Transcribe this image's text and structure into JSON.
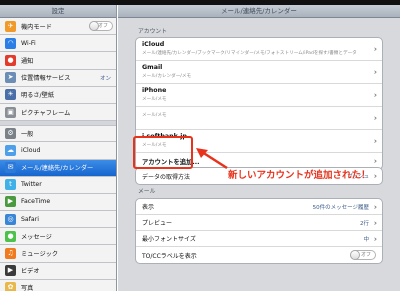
{
  "left": {
    "title": "設定",
    "items": [
      {
        "label": "機内モード",
        "icon": "airplane-icon",
        "color": "#f19a2a",
        "glyph": "✈",
        "toggle": "オフ"
      },
      {
        "label": "Wi-Fi",
        "icon": "wifi-icon",
        "color": "#2a7ee6",
        "glyph": "◠",
        "value": ""
      },
      {
        "label": "通知",
        "icon": "notifications-icon",
        "color": "#e23b2c",
        "glyph": "●"
      },
      {
        "label": "位置情報サービス",
        "icon": "location-icon",
        "color": "#6c8db5",
        "glyph": "➤",
        "value": "オン"
      },
      {
        "label": "明るさ/壁紙",
        "icon": "brightness-icon",
        "color": "#4a6fa8",
        "glyph": "☀"
      },
      {
        "label": "ピクチャフレーム",
        "icon": "picture-frame-icon",
        "color": "#8a8f96",
        "glyph": "▣"
      },
      {
        "label": "一般",
        "icon": "gear-icon",
        "color": "#7b8189",
        "glyph": "⚙",
        "gap": true
      },
      {
        "label": "iCloud",
        "icon": "icloud-icon",
        "color": "#4c9fe8",
        "glyph": "☁"
      },
      {
        "label": "メール/連絡先/カレンダー",
        "icon": "mail-icon",
        "color": "#2b79d8",
        "glyph": "✉",
        "selected": true
      },
      {
        "label": "Twitter",
        "icon": "twitter-icon",
        "color": "#3fb1e8",
        "glyph": "t"
      },
      {
        "label": "FaceTime",
        "icon": "facetime-icon",
        "color": "#4a9a3f",
        "glyph": "▶"
      },
      {
        "label": "Safari",
        "icon": "safari-icon",
        "color": "#3a86d6",
        "glyph": "◎"
      },
      {
        "label": "メッセージ",
        "icon": "messages-icon",
        "color": "#4cc24a",
        "glyph": "●"
      },
      {
        "label": "ミュージック",
        "icon": "music-icon",
        "color": "#f07a1e",
        "glyph": "♫"
      },
      {
        "label": "ビデオ",
        "icon": "video-icon",
        "color": "#3b3b3b",
        "glyph": "▶"
      },
      {
        "label": "写真",
        "icon": "photos-icon",
        "color": "#e8b84a",
        "glyph": "✿"
      }
    ]
  },
  "right": {
    "title": "メール/連絡先/カレンダー",
    "accounts_title": "アカウント",
    "accounts": [
      {
        "name": "iCloud",
        "sub": "メール/連絡先/カレンダー/ブックマーク/リマインダー/メモ/フォトストリーム/iPadを探す/書類とデータ"
      },
      {
        "name": "Gmail",
        "sub": "メール/カレンダー/メモ"
      },
      {
        "name": "iPhone",
        "sub": "メール/メモ"
      },
      {
        "name": "",
        "sub": "メール/メモ"
      },
      {
        "name": "i.softbank.jp",
        "sub": "メール/メモ"
      },
      {
        "name": "アカウントを追加...",
        "sub": ""
      }
    ],
    "fetch": {
      "label": "データの取得方法",
      "value": "プッシュ"
    },
    "mail_title": "メール",
    "mail_rows": [
      {
        "label": "表示",
        "value": "50件のメッセージ履歴"
      },
      {
        "label": "プレビュー",
        "value": "2行"
      },
      {
        "label": "最小フォントサイズ",
        "value": "中"
      },
      {
        "label": "TO/CCラベルを表示",
        "toggle": "オフ"
      }
    ]
  },
  "annotation": {
    "text": "新しいアカウントが追加された！",
    "color": "#e8321c"
  }
}
